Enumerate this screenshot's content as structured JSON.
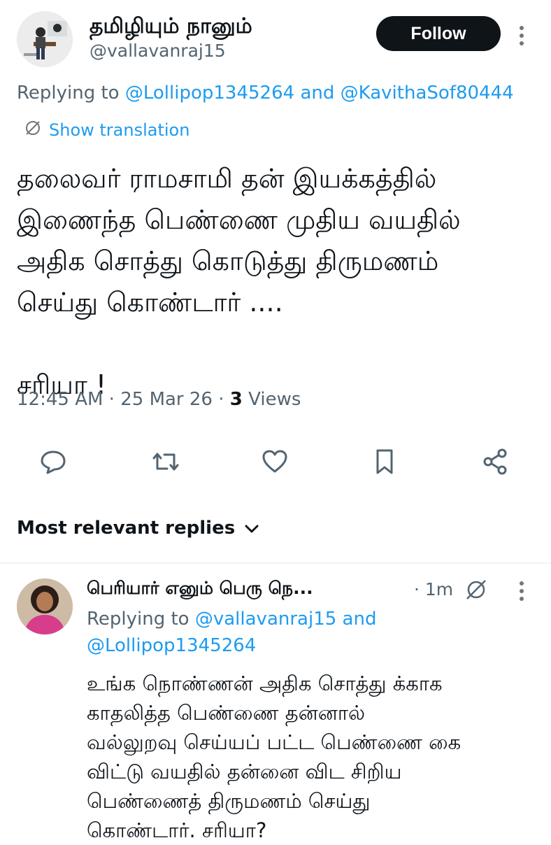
{
  "tweet": {
    "author": {
      "display_name": "தமிழியும் நானும்",
      "handle": "@vallavanraj15"
    },
    "follow_label": "Follow",
    "replying_prefix": "Replying to ",
    "replying_to_1": "@Lollipop1345264",
    "replying_and": " and ",
    "replying_to_2": "@KavithaSof80444",
    "show_translation": "Show translation",
    "text": "தலைவர் ராமசாமி தன் இயக்கத்தில்\nஇணைந்த பெண்ணை முதிய வயதில்\nஅதிக சொத்து கொடுத்து திருமணம்\nசெய்து கொண்டார் ....\n\nசரியா !",
    "time": "12:45 AM",
    "date": "25 Mar 26",
    "views_count": "3",
    "views_label": " Views"
  },
  "actions": {
    "reply_icon": "comment-icon",
    "retweet_icon": "retweet-icon",
    "like_icon": "heart-icon",
    "bookmark_icon": "bookmark-icon",
    "share_icon": "share-icon"
  },
  "replies_section": {
    "label": "Most relevant replies"
  },
  "reply": {
    "display_name": "பெரியார் எனும் பெரு நெ...",
    "time": "1m",
    "replying_prefix": "Replying to ",
    "replying_to_1": "@vallavanraj15",
    "replying_and": " and",
    "replying_to_2": "@Lollipop1345264",
    "text": "உங்க நொண்ணன் அதிக சொத்து க்காக\nகாதலித்த பெண்ணை தன்னால்\nவல்லுறவு செய்யப் பட்ட பெண்ணை கை\nவிட்டு வயதில் தன்னை விட சிறிய\nபெண்ணைத் திருமணம் செய்து\nகொண்டார். சரியா?"
  },
  "colors": {
    "accent": "#1d9bf0",
    "secondary_text": "#536471",
    "follow_bg": "#0f1419"
  }
}
